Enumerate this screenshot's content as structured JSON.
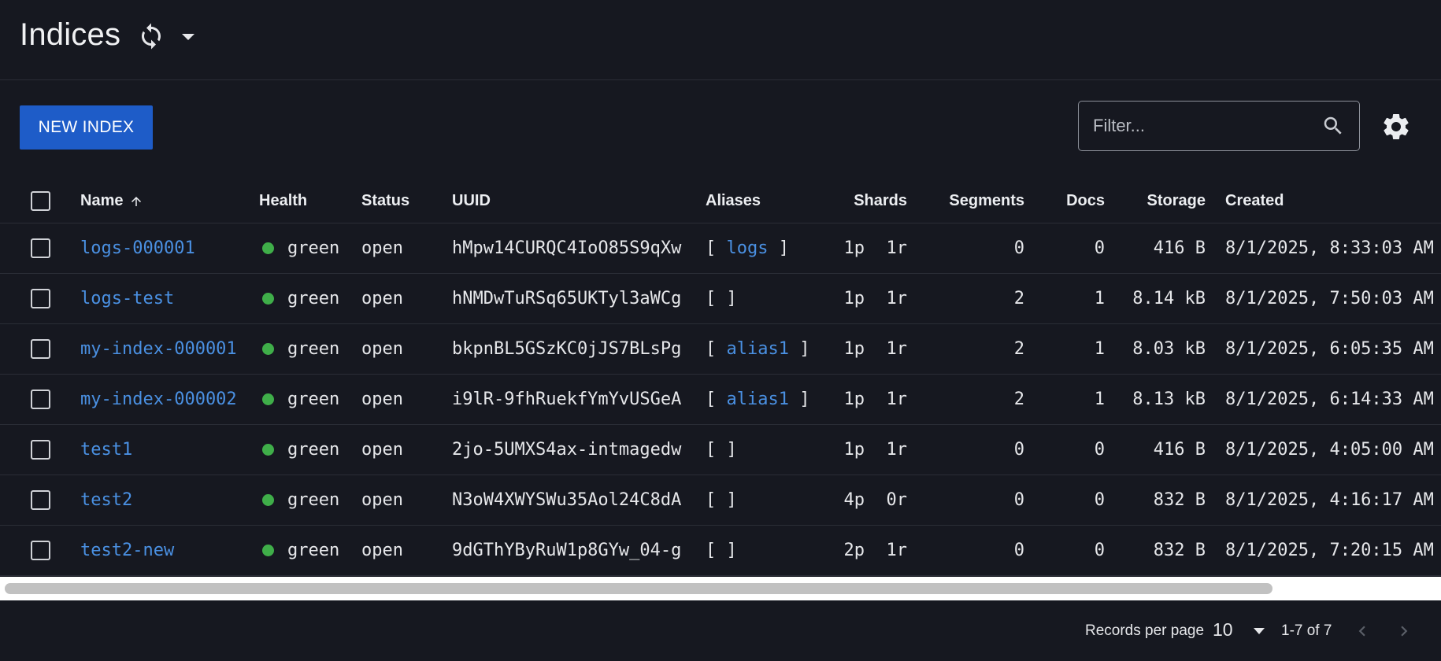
{
  "header": {
    "title": "Indices",
    "refresh_icon": "refresh-icon",
    "caret_icon": "chevron-down-icon"
  },
  "toolbar": {
    "new_index_label": "NEW INDEX",
    "filter_placeholder": "Filter...",
    "filter_value": "",
    "search_icon": "search-icon",
    "settings_icon": "gear-icon"
  },
  "table": {
    "columns": {
      "name": "Name",
      "health": "Health",
      "status": "Status",
      "uuid": "UUID",
      "aliases": "Aliases",
      "shards": "Shards",
      "segments": "Segments",
      "docs": "Docs",
      "storage": "Storage",
      "created": "Created"
    },
    "sort": {
      "column": "Name",
      "direction": "ascending"
    },
    "rows": [
      {
        "name": "logs-000001",
        "health": "green",
        "status": "open",
        "uuid": "hMpw14CURQC4IoO85S9qXw",
        "aliases": [
          "logs"
        ],
        "primaries": "1p",
        "replicas": "1r",
        "segments": "0",
        "docs": "0",
        "storage": "416 B",
        "created": "8/1/2025, 8:33:03 AM"
      },
      {
        "name": "logs-test",
        "health": "green",
        "status": "open",
        "uuid": "hNMDwTuRSq65UKTyl3aWCg",
        "aliases": [],
        "primaries": "1p",
        "replicas": "1r",
        "segments": "2",
        "docs": "1",
        "storage": "8.14 kB",
        "created": "8/1/2025, 7:50:03 AM"
      },
      {
        "name": "my-index-000001",
        "health": "green",
        "status": "open",
        "uuid": "bkpnBL5GSzKC0jJS7BLsPg",
        "aliases": [
          "alias1"
        ],
        "primaries": "1p",
        "replicas": "1r",
        "segments": "2",
        "docs": "1",
        "storage": "8.03 kB",
        "created": "8/1/2025, 6:05:35 AM"
      },
      {
        "name": "my-index-000002",
        "health": "green",
        "status": "open",
        "uuid": "i9lR-9fhRuekfYmYvUSGeA",
        "aliases": [
          "alias1"
        ],
        "primaries": "1p",
        "replicas": "1r",
        "segments": "2",
        "docs": "1",
        "storage": "8.13 kB",
        "created": "8/1/2025, 6:14:33 AM"
      },
      {
        "name": "test1",
        "health": "green",
        "status": "open",
        "uuid": "2jo-5UMXS4ax-intmagedw",
        "aliases": [],
        "primaries": "1p",
        "replicas": "1r",
        "segments": "0",
        "docs": "0",
        "storage": "416 B",
        "created": "8/1/2025, 4:05:00 AM"
      },
      {
        "name": "test2",
        "health": "green",
        "status": "open",
        "uuid": "N3oW4XWYSWu35Aol24C8dA",
        "aliases": [],
        "primaries": "4p",
        "replicas": "0r",
        "segments": "0",
        "docs": "0",
        "storage": "832 B",
        "created": "8/1/2025, 4:16:17 AM"
      },
      {
        "name": "test2-new",
        "health": "green",
        "status": "open",
        "uuid": "9dGThYByRuW1p8GYw_04-g",
        "aliases": [],
        "primaries": "2p",
        "replicas": "1r",
        "segments": "0",
        "docs": "0",
        "storage": "832 B",
        "created": "8/1/2025, 7:20:15 AM"
      }
    ]
  },
  "footer": {
    "records_per_page_label": "Records per page",
    "records_per_page_value": "10",
    "range_text": "1-7 of 7",
    "prev_icon": "chevron-left-icon",
    "next_icon": "chevron-right-icon"
  },
  "colors": {
    "background": "#161820",
    "accent_button": "#1e5cc8",
    "link": "#4a90e2",
    "health_green": "#3fae49",
    "divider": "#2a2d36"
  }
}
